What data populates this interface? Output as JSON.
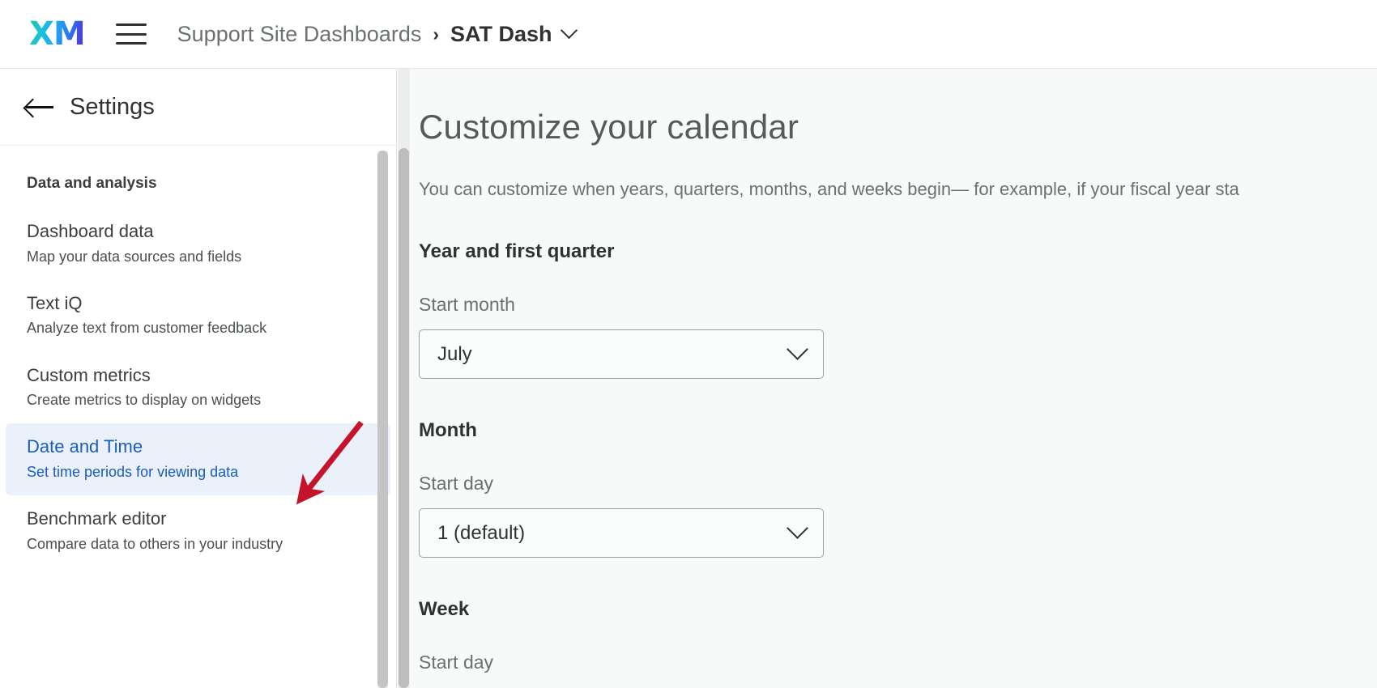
{
  "topbar": {
    "logo_text": "XM",
    "menu_icon": "hamburger-menu-icon",
    "breadcrumb": {
      "root": "Support Site Dashboards",
      "separator": "›",
      "current": "SAT Dash",
      "caret_icon": "chevron-down-icon"
    }
  },
  "sidebar": {
    "back_icon": "arrow-left-icon",
    "title": "Settings",
    "group_label": "Data and analysis",
    "items": [
      {
        "title": "Dashboard data",
        "subtitle": "Map your data sources and fields",
        "active": false
      },
      {
        "title": "Text iQ",
        "subtitle": "Analyze text from customer feedback",
        "active": false
      },
      {
        "title": "Custom metrics",
        "subtitle": "Create metrics to display on widgets",
        "active": false
      },
      {
        "title": "Date and Time",
        "subtitle": "Set time periods for viewing data",
        "active": true
      },
      {
        "title": "Benchmark editor",
        "subtitle": "Compare data to others in your industry",
        "active": false
      }
    ],
    "active_bg": "#eaf1fb",
    "active_text": "#1a5cbf"
  },
  "main": {
    "title": "Customize your calendar",
    "description": "You can customize when years, quarters, months, and weeks begin— for example, if your fiscal year sta",
    "sections": [
      {
        "heading": "Year and first quarter",
        "field_label": "Start month",
        "value": "July",
        "caret_icon": "chevron-down-icon"
      },
      {
        "heading": "Month",
        "field_label": "Start day",
        "value": "1 (default)",
        "caret_icon": "chevron-down-icon"
      },
      {
        "heading": "Week",
        "field_label": "Start day",
        "value": "",
        "caret_icon": "chevron-down-icon"
      }
    ]
  },
  "annotation": {
    "type": "arrow",
    "color": "#c4132b",
    "points_to": "Date and Time"
  }
}
